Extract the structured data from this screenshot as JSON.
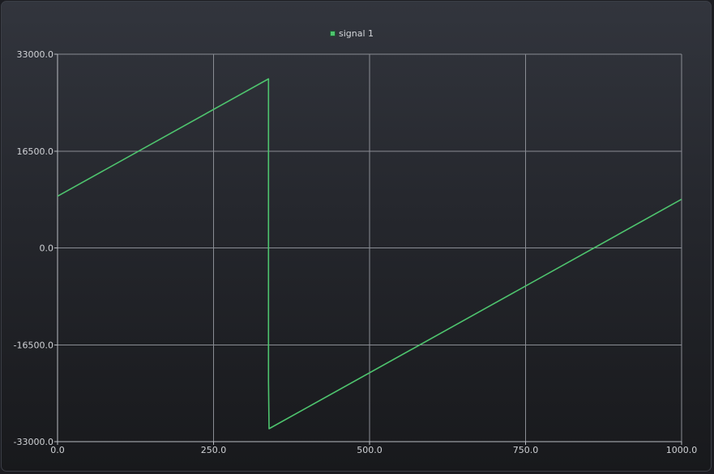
{
  "chart_data": {
    "type": "line",
    "title": "",
    "xlabel": "",
    "ylabel": "",
    "xlim": [
      0,
      1000
    ],
    "ylim": [
      -33000,
      33000
    ],
    "x_ticks": [
      "0.0",
      "250.0",
      "500.0",
      "750.0",
      "1000.0"
    ],
    "y_ticks": [
      "33000.0",
      "16500.0",
      "0.0",
      "-16500.0",
      "-33000.0"
    ],
    "x_tick_values": [
      0,
      250,
      500,
      750,
      1000
    ],
    "y_tick_values": [
      33000,
      16500,
      0,
      -16500,
      -33000
    ],
    "grid": true,
    "legend_position": "top-center",
    "series": [
      {
        "name": "signal 1",
        "color": "#4ec46e",
        "x": [
          0,
          338,
          338,
          339,
          1000
        ],
        "y": [
          8800,
          28800,
          -22700,
          -30800,
          8300
        ]
      }
    ]
  },
  "colors": {
    "grid": "#8a8d94",
    "axis": "#b9bcc2",
    "series": "#4ec46e"
  }
}
